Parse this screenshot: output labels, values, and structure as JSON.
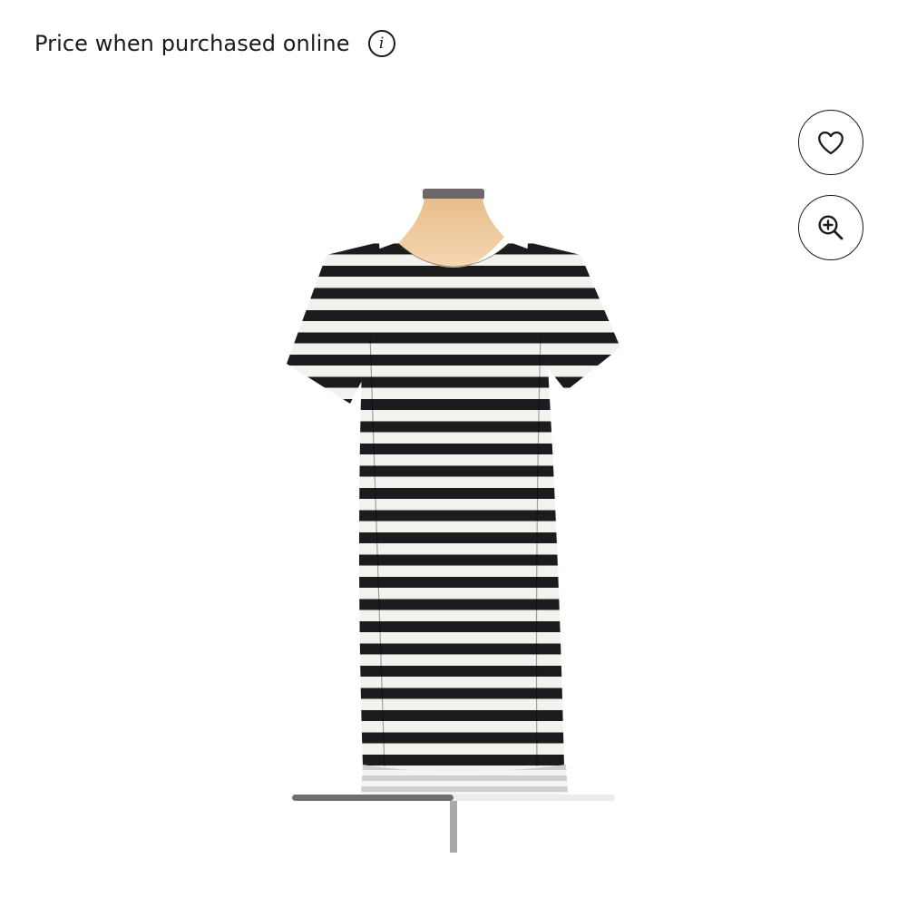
{
  "price_label": "Price when purchased online",
  "info_icon": "info-icon",
  "icons": {
    "favorite": "heart-icon",
    "zoom": "zoom-in-icon"
  },
  "product": {
    "colors": {
      "stripe_dark": "#1c1c1e",
      "stripe_light": "#f3f2ee",
      "mannequin": "#f0cda2"
    }
  },
  "carousel": {
    "position": 0.5
  }
}
